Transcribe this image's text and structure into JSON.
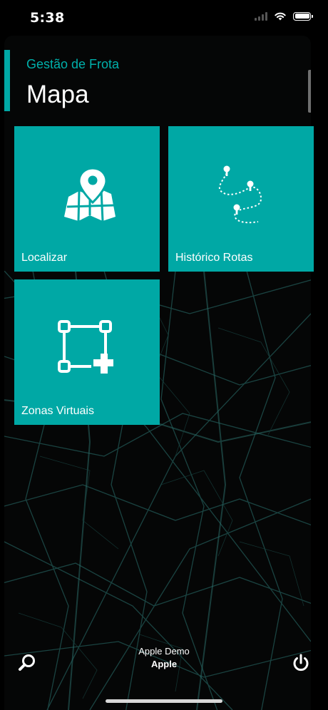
{
  "status_bar": {
    "time": "5:38"
  },
  "header": {
    "subtitle": "Gestão de Frota",
    "title": "Mapa"
  },
  "tiles": [
    {
      "label": "Localizar",
      "icon": "map-pin-icon"
    },
    {
      "label": "Histórico Rotas",
      "icon": "route-history-icon"
    },
    {
      "label": "Zonas Virtuais",
      "icon": "virtual-zone-icon"
    }
  ],
  "footer": {
    "user_line1": "Apple Demo",
    "user_line2": "Apple"
  },
  "colors": {
    "accent": "#00a8a5",
    "background": "#050606",
    "map_lines": "#1d4a48"
  }
}
